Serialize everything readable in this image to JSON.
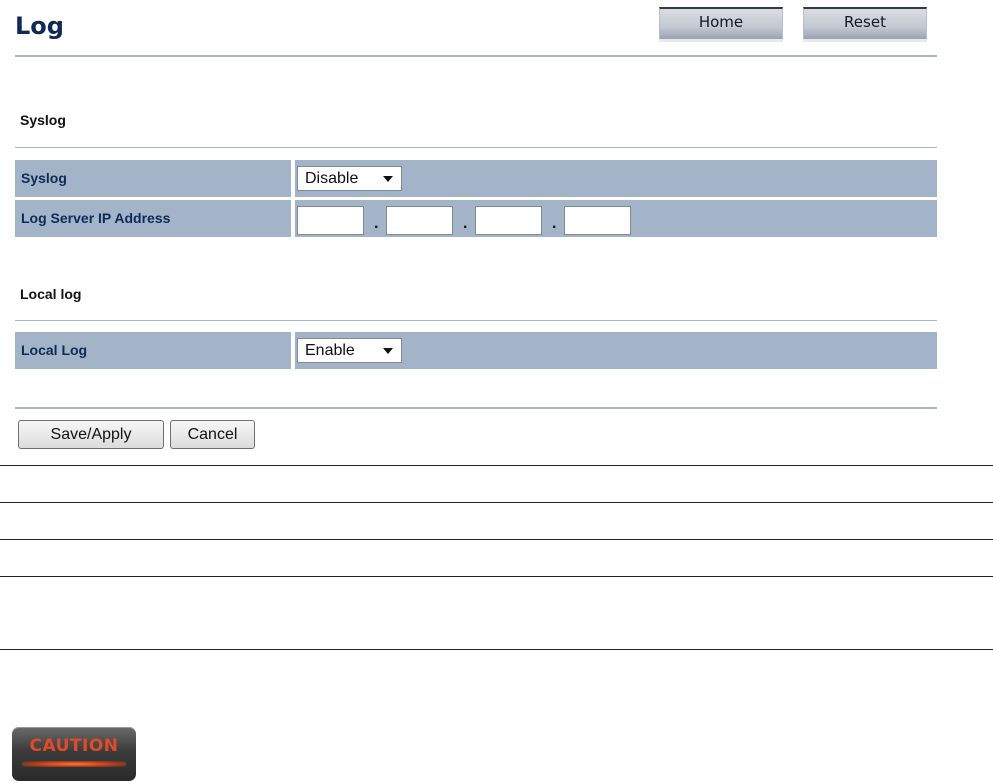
{
  "page": {
    "title": "Log"
  },
  "header": {
    "home_label": "Home",
    "reset_label": "Reset"
  },
  "syslog_section": {
    "heading": "Syslog",
    "syslog_row": {
      "label": "Syslog",
      "selected": "Disable"
    },
    "server_ip_row": {
      "label": "Log Server IP Address",
      "octets": [
        "",
        "",
        "",
        ""
      ],
      "separator": "."
    }
  },
  "local_log_section": {
    "heading": "Local log",
    "local_log_row": {
      "label": "Local Log",
      "selected": "Enable"
    }
  },
  "actions": {
    "save_label": "Save/Apply",
    "cancel_label": "Cancel"
  },
  "caution_badge": {
    "label": "CAUTION"
  },
  "colors": {
    "title": "#0f2a55",
    "row_background": "#a3b4c9",
    "row_label": "#0e2a57",
    "rule": "#a9b8c6",
    "caution_text": "#e24a2a"
  },
  "icons": {
    "select_caret": "chevron-down-icon"
  }
}
